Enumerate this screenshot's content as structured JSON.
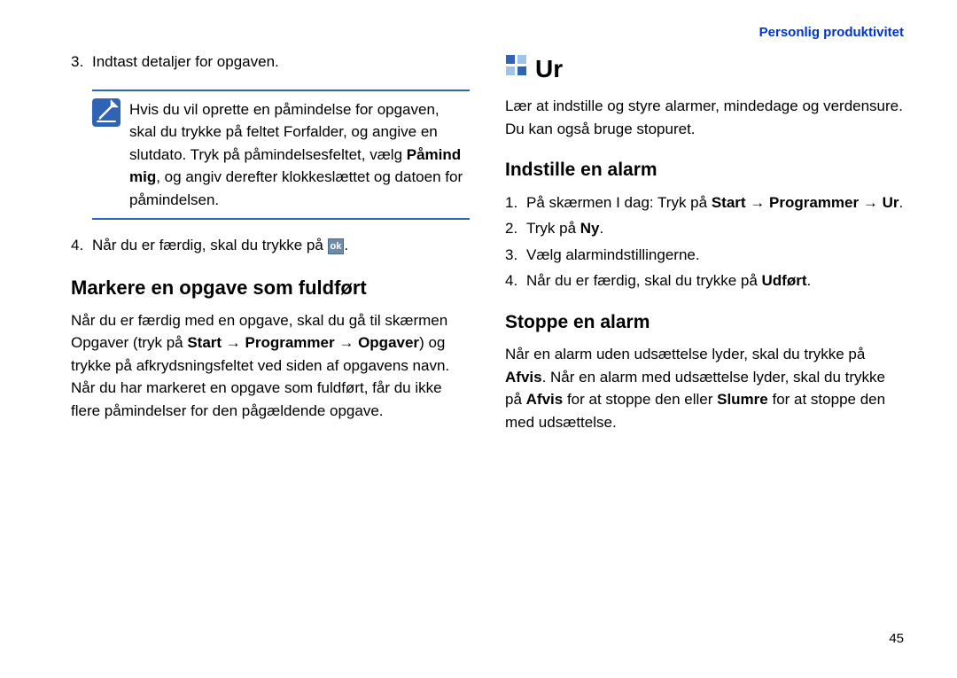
{
  "header": {
    "title": "Personlig produktivitet"
  },
  "left": {
    "steps": [
      {
        "n": "3.",
        "text": "Indtast detaljer for opgaven."
      },
      {
        "n": "4.",
        "pre": "Når du er færdig, skal du trykke på ",
        "ok": "ok",
        "post": "."
      }
    ],
    "note": {
      "pre": "Hvis du vil oprette en påmindelse for opgaven, skal du trykke på feltet Forfalder, og angive en slutdato. Tryk på påmindelsesfeltet, vælg ",
      "b1": "Påmind mig",
      "post": ", og angiv derefter klokkeslættet og datoen for påmindelsen."
    },
    "mark": {
      "title": "Markere en opgave som fuldført",
      "pre": "Når du er færdig med en opgave, skal du gå til skærmen Opgaver (tryk på ",
      "b1": "Start",
      "arrow1": " → ",
      "b2": "Programmer",
      "arrow2": " → ",
      "b3": "Opgaver",
      "post": ") og trykke på afkrydsningsfeltet ved siden af opgavens navn. Når du har markeret en opgave som fuldført, får du ikke flere påmindelser for den pågældende opgave."
    }
  },
  "right": {
    "chapter": "Ur",
    "intro": "Lær at indstille og styre alarmer, mindedage og verdensure. Du kan også bruge stopuret.",
    "alarm_set": {
      "title": "Indstille en alarm",
      "steps": [
        {
          "n": "1.",
          "pre": "På skærmen I dag: Tryk på ",
          "b1": "Start",
          "arrow1": " → ",
          "b2": "Programmer",
          "arrow2": " → ",
          "b3": "Ur",
          "post": "."
        },
        {
          "n": "2.",
          "pre": "Tryk på ",
          "b1": "Ny",
          "post": "."
        },
        {
          "n": "3.",
          "pre": "Vælg alarmindstillingerne."
        },
        {
          "n": "4.",
          "pre": "Når du er færdig, skal du trykke på ",
          "b1": "Udført",
          "post": "."
        }
      ]
    },
    "alarm_stop": {
      "title": "Stoppe en alarm",
      "pre": "Når en alarm uden udsættelse lyder, skal du trykke på ",
      "b1": "Afvis",
      "mid1": ". Når en alarm med udsættelse lyder, skal du trykke på ",
      "b2": "Afvis",
      "mid2": " for at stoppe den eller ",
      "b3": "Slumre",
      "post": " for at stoppe den med udsættelse."
    }
  },
  "page_num": "45"
}
